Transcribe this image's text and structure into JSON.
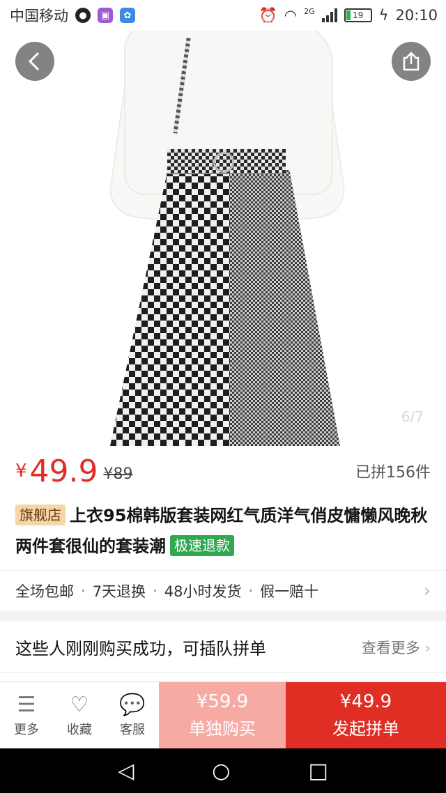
{
  "status_bar": {
    "carrier": "中国移动",
    "network": "2G",
    "battery": "19",
    "time": "20:10"
  },
  "gallery": {
    "counter": "6/7"
  },
  "product": {
    "currency": "¥",
    "price": "49.9",
    "original_price": "¥89",
    "sold": "已拼156件",
    "shop_badge": "旗舰店",
    "title": "上衣95棉韩版套装网红气质洋气俏皮慵懒风晚秋两件套很仙的套装潮",
    "refund_badge": "极速退款"
  },
  "services": {
    "items": [
      "全场包邮",
      "7天退换",
      "48小时发货",
      "假一赔十"
    ]
  },
  "group_section": {
    "title": "这些人刚刚购买成功，可插队拼单",
    "more": "查看更多"
  },
  "bottom_bar": {
    "more_label": "更多",
    "fav_label": "收藏",
    "service_label": "客服",
    "single_price": "¥59.9",
    "single_label": "单独购买",
    "group_price": "¥49.9",
    "group_label": "发起拼单"
  },
  "colors": {
    "accent": "#e02e24",
    "single_buy_bg": "#f6aaa3",
    "refund_badge_bg": "#2fa84f",
    "shop_badge_bg": "#f5d6a8"
  }
}
